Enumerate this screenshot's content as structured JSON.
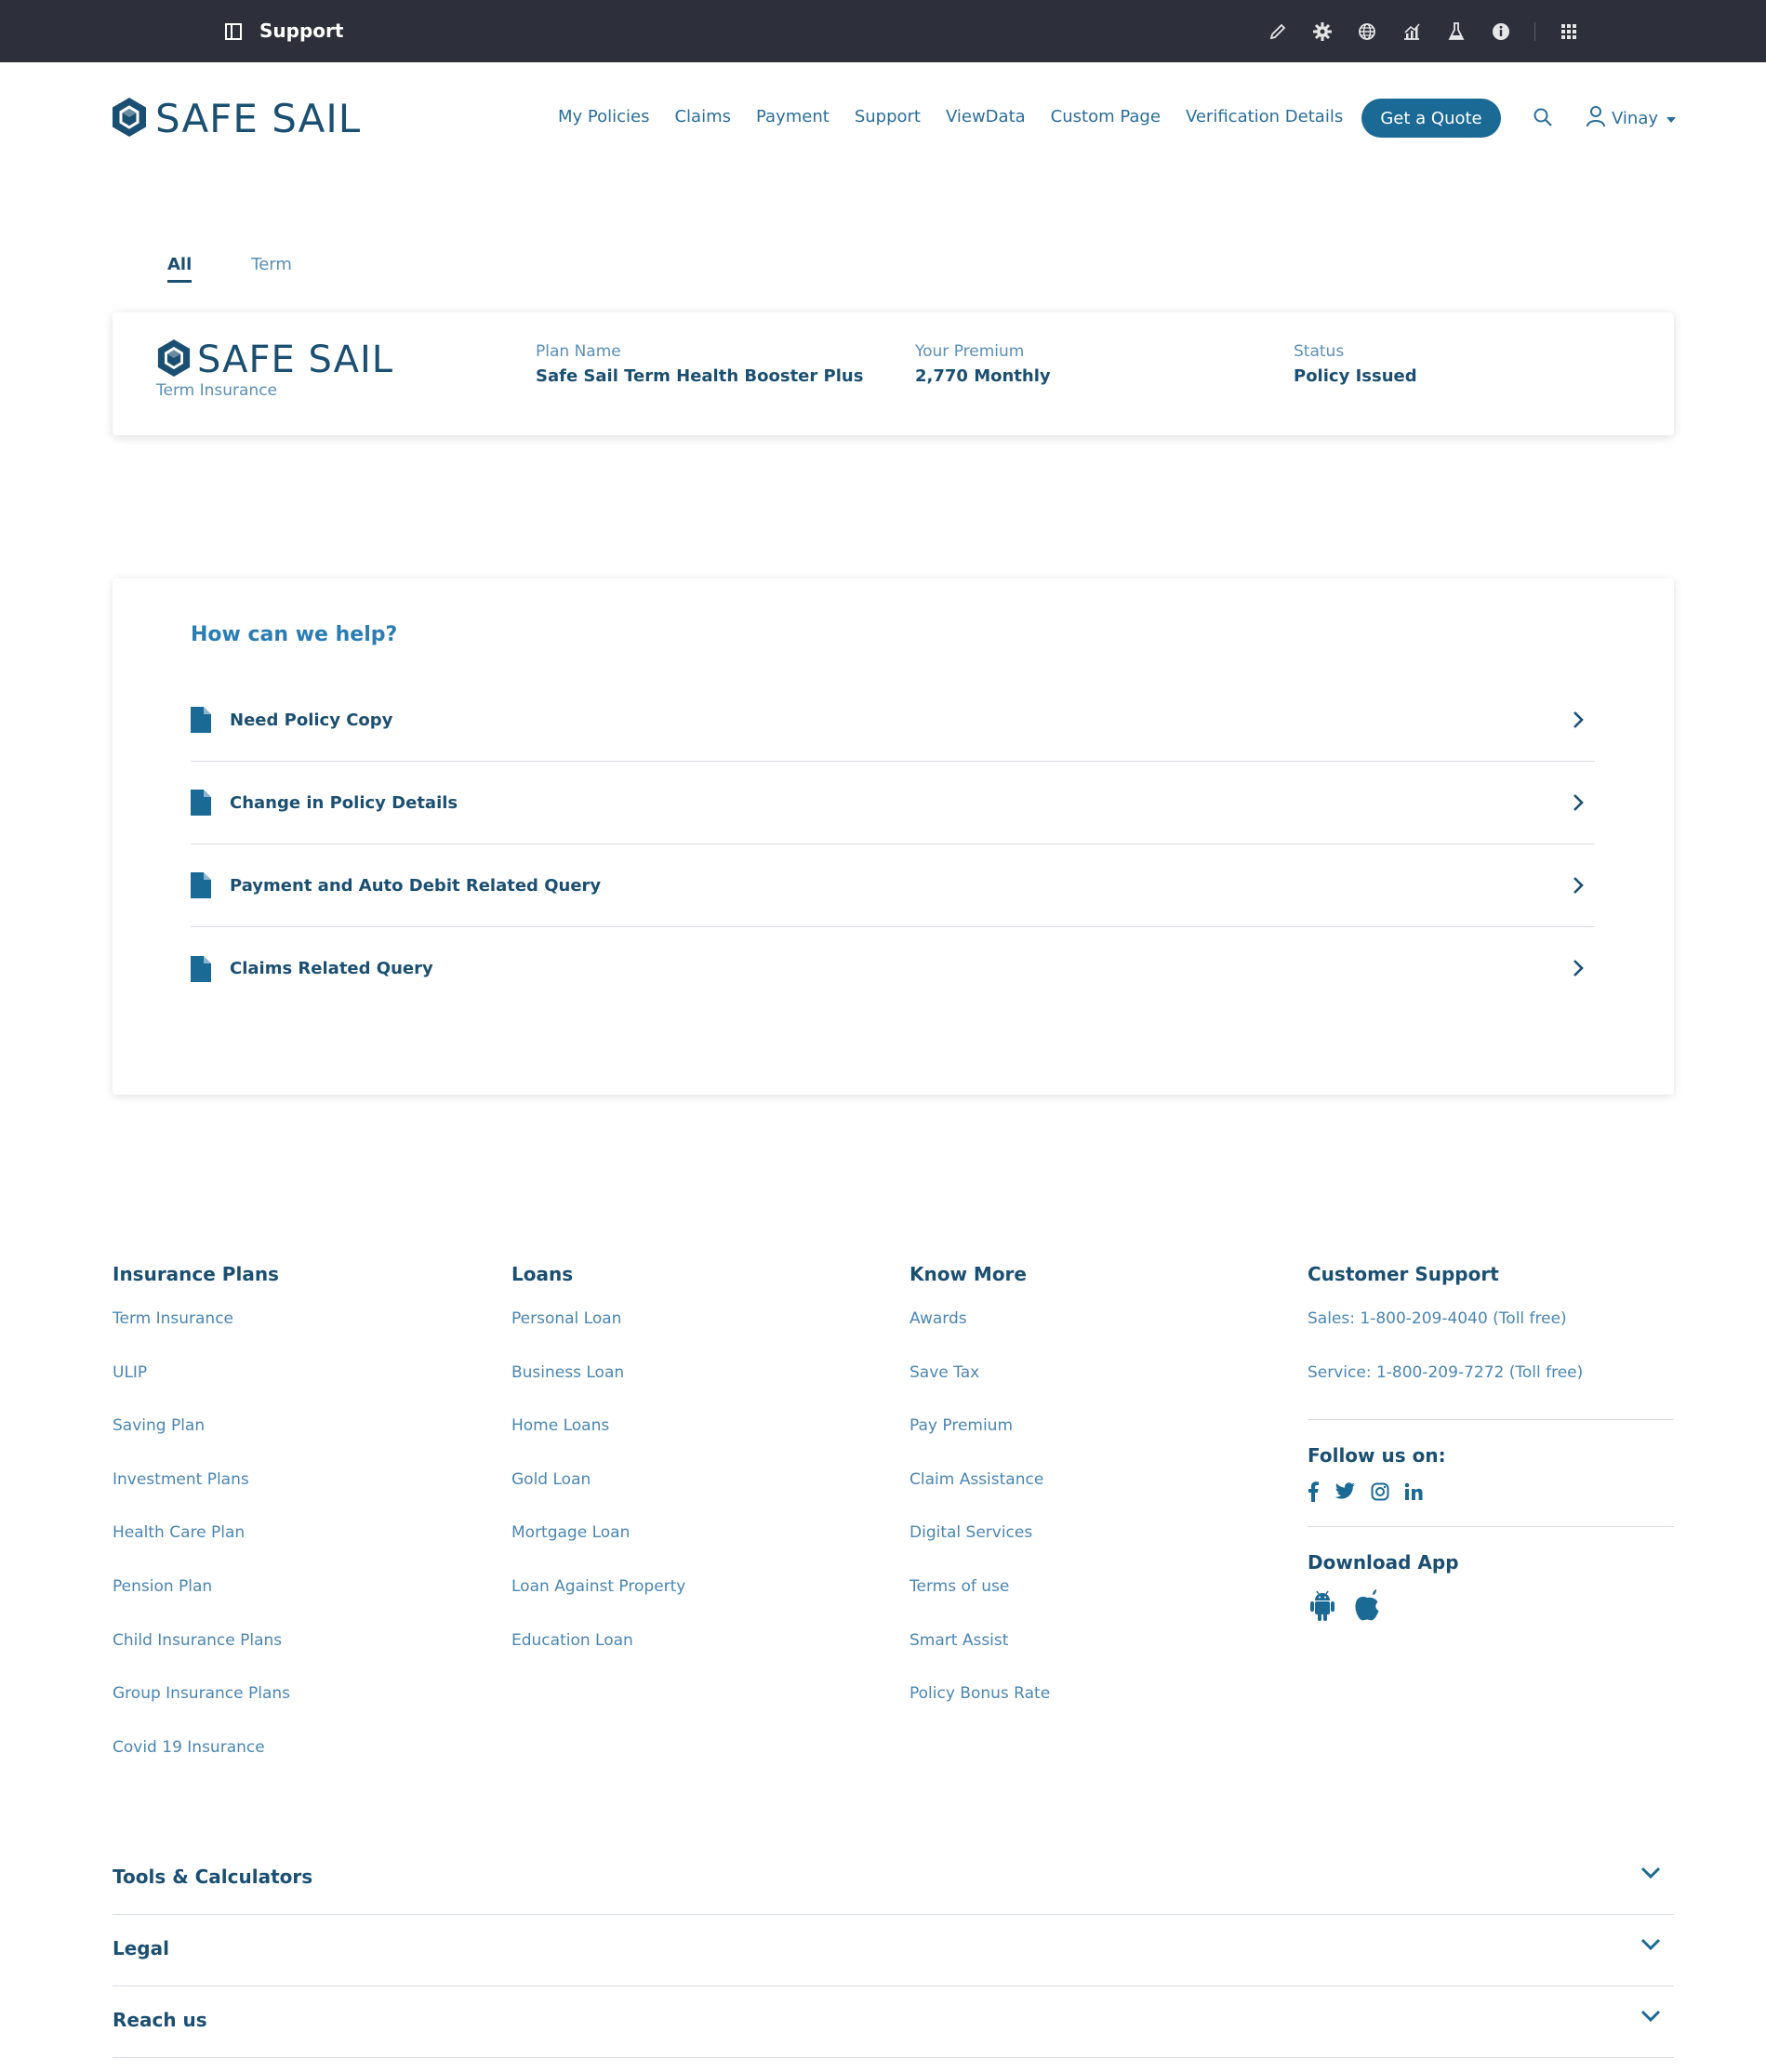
{
  "topbar": {
    "title": "Support",
    "tools": [
      "pencil-icon",
      "gear-icon",
      "globe-icon",
      "chart-icon",
      "flask-icon",
      "info-icon",
      "apps-grid-icon"
    ]
  },
  "header": {
    "logo_text": "SAFE SAIL",
    "nav": [
      "My Policies",
      "Claims",
      "Payment",
      "Support",
      "ViewData",
      "Custom Page",
      "Verification Details"
    ],
    "quote_button": "Get a Quote",
    "user_name": "Vinay"
  },
  "tabs": [
    {
      "label": "All",
      "active": true
    },
    {
      "label": "Term",
      "active": false
    }
  ],
  "policy_card": {
    "logo_text": "SAFE SAIL",
    "subtitle": "Term Insurance",
    "plan_label": "Plan Name",
    "plan_value": "Safe Sail Term Health Booster Plus",
    "premium_label": "Your Premium",
    "premium_value": "2,770 Monthly",
    "status_label": "Status",
    "status_value": "Policy Issued"
  },
  "help": {
    "title": "How can we help?",
    "items": [
      "Need Policy Copy",
      "Change in Policy Details",
      "Payment and Auto Debit Related Query",
      "Claims Related Query"
    ]
  },
  "footer": {
    "insurance": {
      "title": "Insurance Plans",
      "links": [
        "Term Insurance",
        "ULIP",
        "Saving Plan",
        "Investment Plans",
        "Health Care Plan",
        "Pension Plan",
        "Child Insurance Plans",
        "Group Insurance Plans",
        "Covid 19 Insurance"
      ]
    },
    "loans": {
      "title": "Loans",
      "links": [
        "Personal Loan",
        "Business Loan",
        "Home Loans",
        "Gold Loan",
        "Mortgage Loan",
        "Loan Against Property",
        "Education Loan"
      ]
    },
    "know_more": {
      "title": "Know More",
      "links": [
        "Awards",
        "Save Tax",
        "Pay Premium",
        "Claim Assistance",
        "Digital Services",
        "Terms of use",
        "Smart Assist",
        "Policy Bonus Rate"
      ]
    },
    "support": {
      "title": "Customer Support",
      "sales": "Sales: 1-800-209-4040 (Toll free)",
      "service": "Service: 1-800-209-7272 (Toll free)",
      "follow_title": "Follow us on:",
      "download_title": "Download App"
    }
  },
  "accordions": [
    "Tools & Calculators",
    "Legal",
    "Reach us"
  ],
  "colors": {
    "topbar": "#2d2f3a",
    "brand": "#1b4f72",
    "accent": "#1b6a96",
    "link": "#4a86b3"
  }
}
